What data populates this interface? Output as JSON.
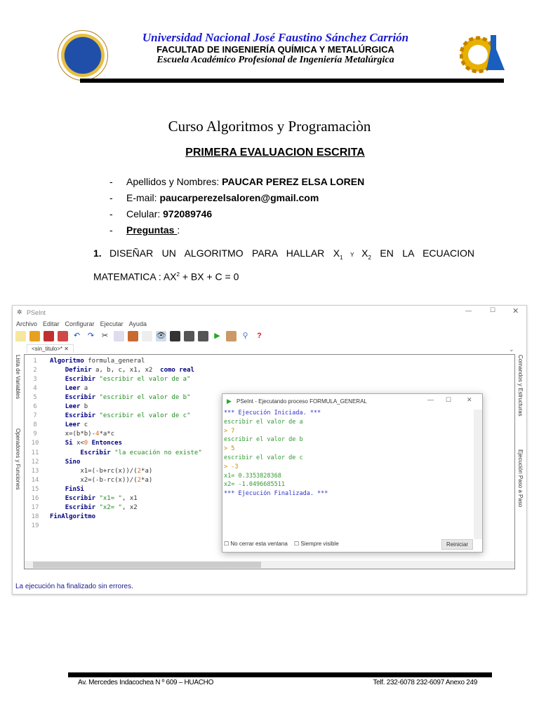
{
  "header": {
    "university": "Universidad Nacional José Faustino Sánchez Carrión",
    "faculty": "FACULTAD DE INGENIERÍA QUÍMICA Y METALÚRGICA",
    "school": "Escuela Académico Profesional de Ingeniería Metalúrgica"
  },
  "course": "Curso Algoritmos y Programaciòn",
  "eval_title": "PRIMERA EVALUACION ESCRITA",
  "info": {
    "name_label": "Apellidos y Nombres: ",
    "name": "PAUCAR PEREZ ELSA LOREN",
    "email_label": "E-mail: ",
    "email": "paucarperezelsaloren@gmail.com",
    "phone_label": "Celular: ",
    "phone": "972089746",
    "questions": "Preguntas ",
    "colon": ":",
    "dash": "-"
  },
  "question": {
    "num": "1.",
    "text_a": "DISEÑAR UN ALGORITMO PARA HALLAR X",
    "sub1": "1",
    "y": " Y ",
    "x2": "X",
    "sub2": "2",
    "text_b": " EN LA ECUACION MATEMATICA : AX",
    "sup": "2",
    "text_c": " + BX  + C = 0"
  },
  "pseint": {
    "title": "PSeInt",
    "menu": [
      "Archivo",
      "Editar",
      "Configurar",
      "Ejecutar",
      "Ayuda"
    ],
    "tab": "<sin_titulo>*",
    "left_panels": [
      "Lista de Variables",
      "Operadores y Funciones"
    ],
    "right_panels": [
      "Comandos y Estructuras",
      "Ejecución Paso a Paso"
    ],
    "code": [
      [
        [
          "kw",
          "Algoritmo"
        ],
        [
          "txt",
          " formula_general"
        ]
      ],
      [
        [
          "txt",
          "    "
        ],
        [
          "kw",
          "Definir"
        ],
        [
          "txt",
          " a, b, c, x1, x2  "
        ],
        [
          "kw",
          "como real"
        ]
      ],
      [
        [
          "txt",
          "    "
        ],
        [
          "kw",
          "Escribir"
        ],
        [
          "str",
          " \"escribir el valor de a\""
        ]
      ],
      [
        [
          "txt",
          "    "
        ],
        [
          "kw",
          "Leer"
        ],
        [
          "txt",
          " a"
        ]
      ],
      [
        [
          "txt",
          "    "
        ],
        [
          "kw",
          "Escribir"
        ],
        [
          "str",
          " \"escribir el valor de b\""
        ]
      ],
      [
        [
          "txt",
          "    "
        ],
        [
          "kw",
          "Leer"
        ],
        [
          "txt",
          " b"
        ]
      ],
      [
        [
          "txt",
          "    "
        ],
        [
          "kw",
          "Escribir"
        ],
        [
          "str",
          " \"escribir el valor de c\""
        ]
      ],
      [
        [
          "txt",
          "    "
        ],
        [
          "kw",
          "Leer"
        ],
        [
          "txt",
          " c"
        ]
      ],
      [
        [
          "txt",
          "    x=(b*b)-"
        ],
        [
          "num",
          "4"
        ],
        [
          "txt",
          "*a*c"
        ]
      ],
      [
        [
          "txt",
          "    "
        ],
        [
          "kw",
          "Si"
        ],
        [
          "txt",
          " x<"
        ],
        [
          "num",
          "0"
        ],
        [
          "kw",
          " Entonces"
        ]
      ],
      [
        [
          "txt",
          "        "
        ],
        [
          "kw",
          "Escribir"
        ],
        [
          "str",
          " \"la ecuación no existe\""
        ]
      ],
      [
        [
          "txt",
          "    "
        ],
        [
          "kw",
          "Sino"
        ]
      ],
      [
        [
          "txt",
          "        x1=(-b+rc(x))/("
        ],
        [
          "num",
          "2"
        ],
        [
          "txt",
          "*a)"
        ]
      ],
      [
        [
          "txt",
          "        x2=(-b-rc(x))/("
        ],
        [
          "num",
          "2"
        ],
        [
          "txt",
          "*a)"
        ]
      ],
      [
        [
          "txt",
          "    "
        ],
        [
          "kw",
          "FinSi"
        ]
      ],
      [
        [
          "txt",
          "    "
        ],
        [
          "kw",
          "Escribir"
        ],
        [
          "str",
          " \"x1= \""
        ],
        [
          "txt",
          ", x1"
        ]
      ],
      [
        [
          "txt",
          "    "
        ],
        [
          "kw",
          "Escribir"
        ],
        [
          "str",
          " \"x2= \""
        ],
        [
          "txt",
          ", x2"
        ]
      ],
      [
        [
          "kw",
          "FinAlgoritmo"
        ]
      ],
      [
        [
          "txt",
          ""
        ]
      ]
    ],
    "status": "La ejecución ha finalizado sin errores.",
    "run": {
      "title": "PSeInt - Ejecutando proceso FORMULA_GENERAL",
      "lines": [
        [
          "#3333cc",
          "*** Ejecución Iniciada. ***"
        ],
        [
          "#339933",
          "escribir el valor de a"
        ],
        [
          "#cc8800",
          "> 7"
        ],
        [
          "#339933",
          "escribir el valor de b"
        ],
        [
          "#cc8800",
          "> 5"
        ],
        [
          "#339933",
          "escribir el valor de c"
        ],
        [
          "#cc8800",
          "> -3"
        ],
        [
          "#339933",
          "x1= 0.3353828368"
        ],
        [
          "#339933",
          "x2= -1.0496685511"
        ],
        [
          "#3333cc",
          "*** Ejecución Finalizada. ***"
        ]
      ],
      "no_close": "No cerrar esta ventana",
      "always_visible": "Siempre visible",
      "restart": "Reiniciar"
    }
  },
  "footer": {
    "address": "Av. Mercedes Indacochea N º 609 – HUACHO",
    "phone": "Telf. 232-6078    232-6097 Anexo 249"
  }
}
